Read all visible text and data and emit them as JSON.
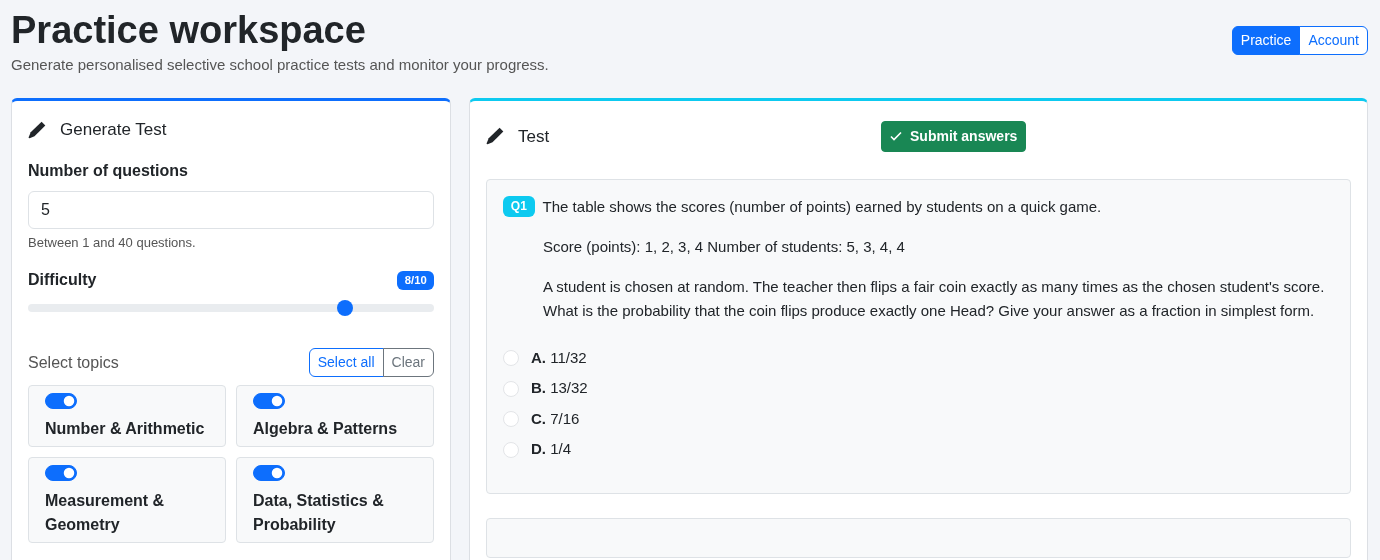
{
  "header": {
    "title": "Practice workspace",
    "subtitle": "Generate personalised selective school practice tests and monitor your progress."
  },
  "nav": [
    {
      "label": "Practice",
      "selected": true
    },
    {
      "label": "Account",
      "selected": false
    }
  ],
  "generate": {
    "title": "Generate Test",
    "count_label": "Number of questions",
    "count_value": "5",
    "count_help": "Between 1 and 40 questions.",
    "difficulty_label": "Difficulty",
    "difficulty_reading": "8/10",
    "difficulty": {
      "level": 0.78
    },
    "topics_label": "Select topics",
    "topic_actions": [
      {
        "label": "Select all",
        "kind": "primary"
      },
      {
        "label": "Clear",
        "kind": "secondary"
      }
    ],
    "topics": [
      {
        "label": "Number & Arithmetic",
        "on": true
      },
      {
        "label": "Algebra & Patterns",
        "on": true
      },
      {
        "label": "Measurement & Geometry",
        "on": true
      },
      {
        "label": "Data, Statistics & Probability",
        "on": true
      }
    ]
  },
  "test": {
    "title": "Test",
    "submit": "Submit answers",
    "questions": [
      {
        "badge": "Q1",
        "intro": "The table shows the scores (number of points) earned by students on a quick game.",
        "paragraphs": [
          "Score (points): 1, 2, 3, 4 Number of students: 5, 3, 4, 4",
          "A student is chosen at random. The teacher then flips a fair coin exactly as many times as the chosen student's score. What is the probability that the coin flips produce exactly one Head? Give your answer as a fraction in simplest form."
        ],
        "options": [
          {
            "letter": "A.",
            "text": "11/32",
            "selected": false
          },
          {
            "letter": "B.",
            "text": "13/32",
            "selected": false
          },
          {
            "letter": "C.",
            "text": "7/16",
            "selected": false
          },
          {
            "letter": "D.",
            "text": "1/4",
            "selected": false
          }
        ]
      }
    ]
  }
}
